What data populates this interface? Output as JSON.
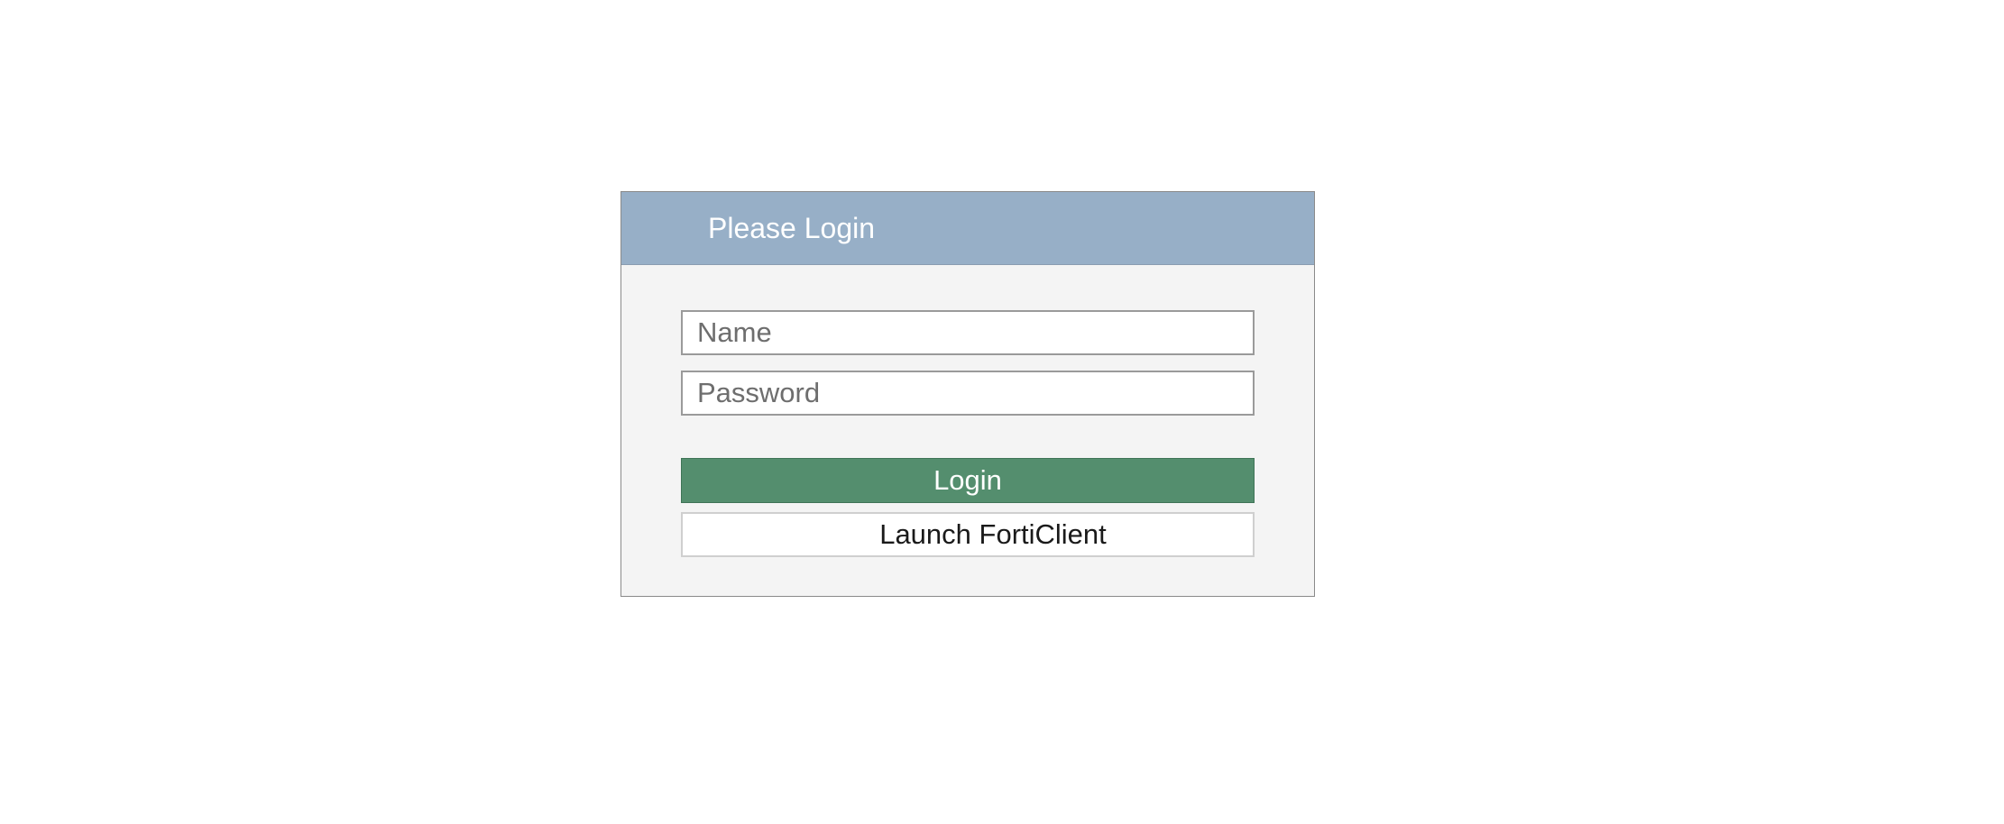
{
  "login_panel": {
    "title": "Please Login",
    "name_field": {
      "placeholder": "Name",
      "value": ""
    },
    "password_field": {
      "placeholder": "Password",
      "value": ""
    },
    "login_button_label": "Login",
    "forticlient_button_label": "Launch FortiClient"
  },
  "colors": {
    "header_bg": "#97afc7",
    "panel_bg": "#f4f4f4",
    "login_button_bg": "#548e6e"
  }
}
